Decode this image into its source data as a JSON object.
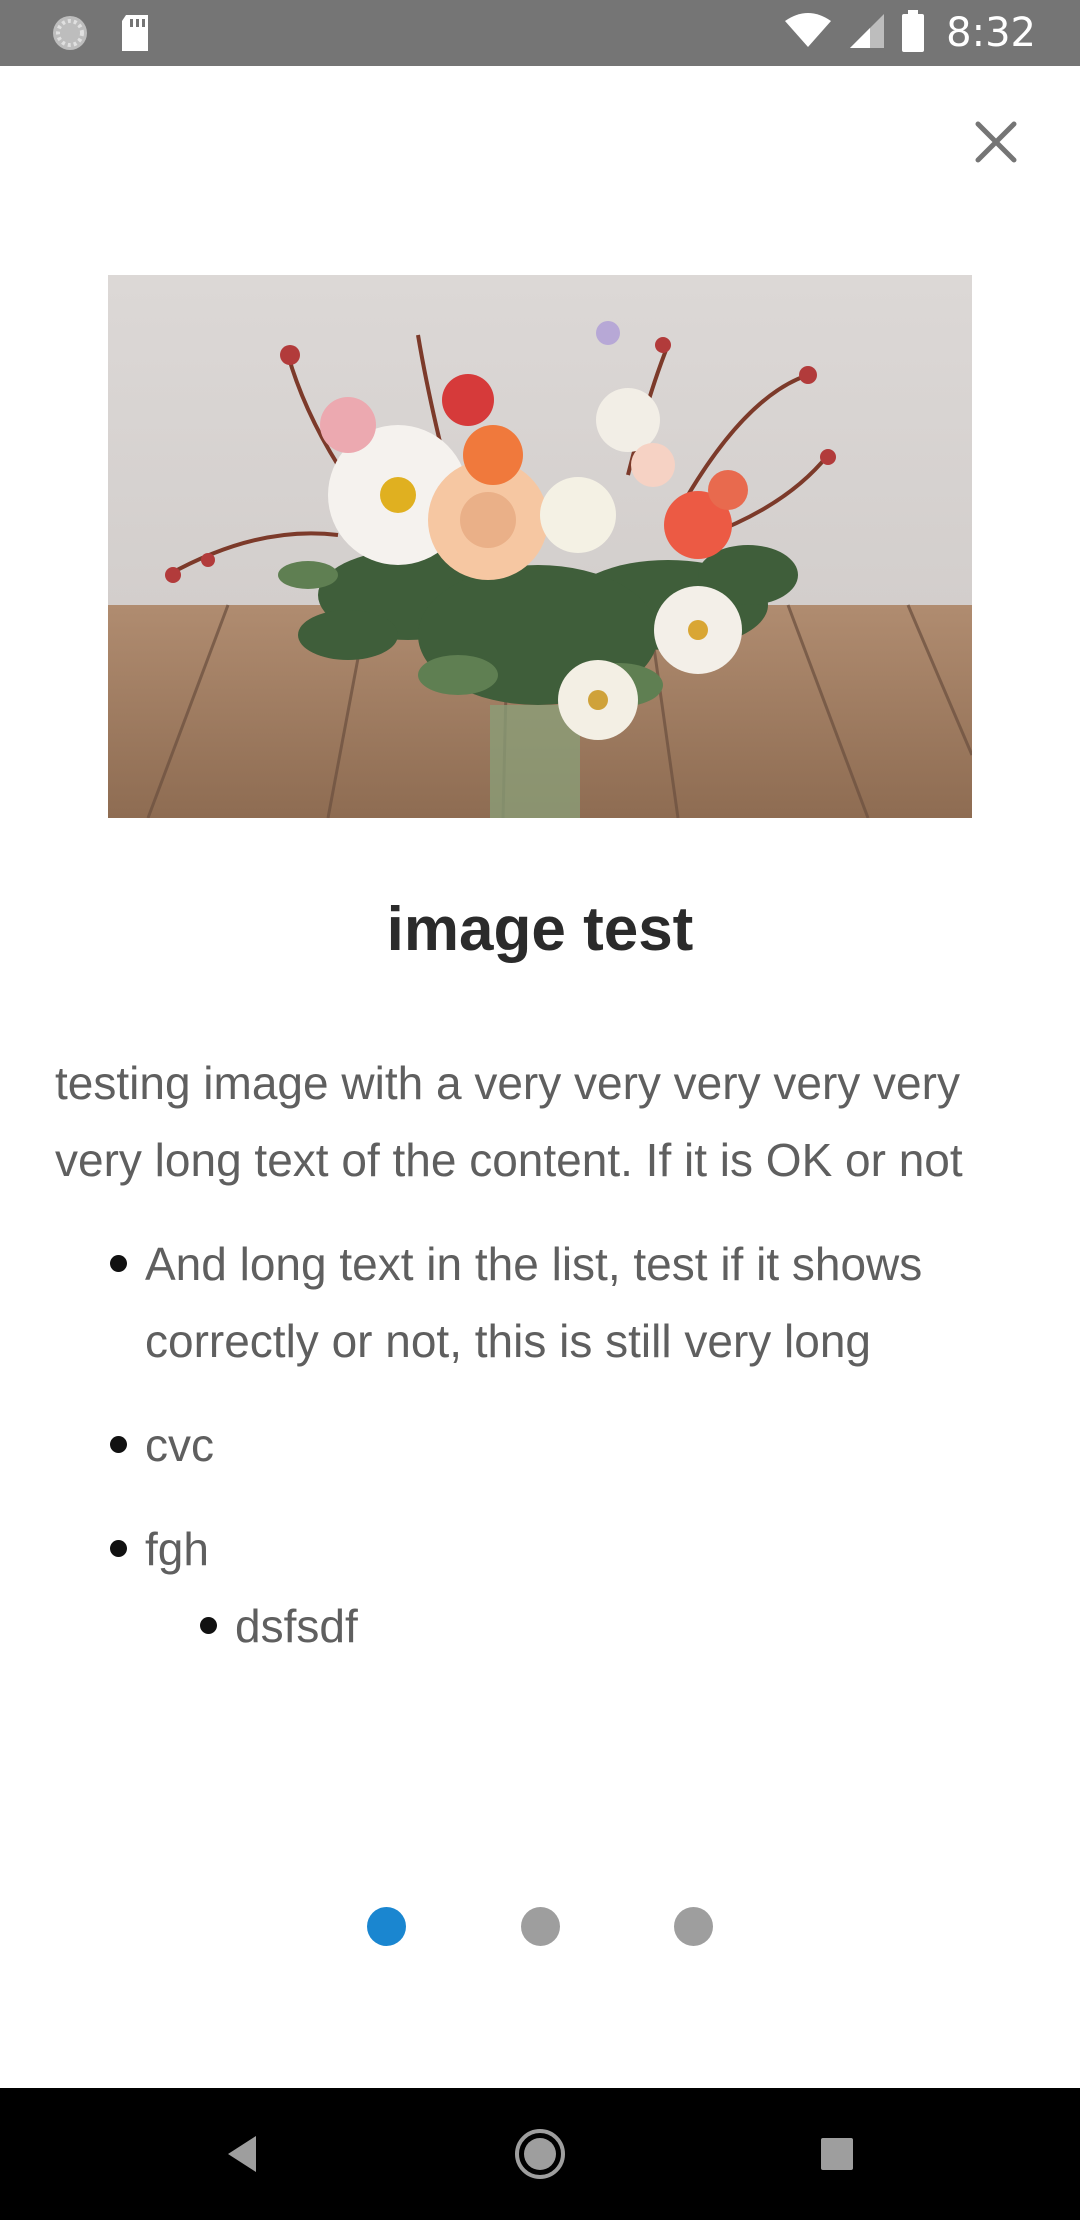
{
  "status_bar": {
    "time": "8:32",
    "icons": [
      "sync-icon",
      "sd-card-icon",
      "wifi-icon",
      "signal-icon",
      "battery-icon"
    ]
  },
  "close_icon": "close-icon",
  "content": {
    "title": "image test",
    "body": "testing image with a very very very very very very long text of the content. If it is OK or not",
    "list": [
      "And long text in the list, test if it shows correctly or not, this is still very long",
      "cvc",
      "fgh"
    ],
    "sublist": [
      "dsfsdf"
    ]
  },
  "pagination": {
    "count": 3,
    "active_index": 0,
    "active_color": "#1a86d0",
    "inactive_color": "#9e9e9e"
  },
  "nav_bar": {
    "buttons": [
      "back-icon",
      "home-icon",
      "recents-icon"
    ]
  },
  "colors": {
    "status_bar": "#757575",
    "title": "#2b2b2b",
    "body_text": "#5f5f5f"
  }
}
